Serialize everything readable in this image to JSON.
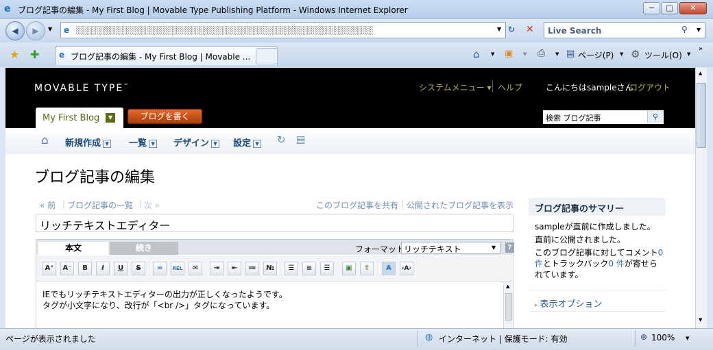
{
  "window": {
    "title": "ブログ記事の編集 - My First Blog | Movable Type Publishing Platform - Windows Internet Explorer",
    "min": "─",
    "max": "□",
    "close": "✕"
  },
  "addressbar": {
    "url_obscured": "░░░░░░░░░░░░░░░░░░░░░░░░░░░░░░░░░░░░░░░░░░░░░░░░░░░░░░░░░░░░░░░░░░░░░░░░░░░░░",
    "search_placeholder": "Live Search"
  },
  "tabs": {
    "active_label": "ブログ記事の編集 - My First Blog | Movable ...",
    "page_label": "ページ(P)",
    "tools_label": "ツール(O)"
  },
  "mt": {
    "logo": "MOVABLE TYPE",
    "logo_tm": "™",
    "system_menu": "システムメニュー ▾",
    "help": "ヘルプ",
    "greeting": "こんにちはsampleさん",
    "logout": "ログアウト",
    "blog_name": "My First Blog",
    "write_button": "ブログを書く",
    "search_placeholder": "検索 ブログ記事",
    "nav": {
      "new": "新規作成",
      "list": "一覧",
      "design": "デザイン",
      "settings": "設定"
    },
    "page_title": "ブログ記事の編集",
    "crumbs": {
      "prev": "« 前",
      "list": "ブログ記事の一覧",
      "next": "次 »",
      "share": "このブログ記事を共有",
      "view": "公開されたブログ記事を表示"
    },
    "entry_title": "リッチテキストエディター",
    "editor": {
      "tab_body": "本文",
      "tab_more": "続き",
      "format_label": "フォーマット:",
      "format_value": "リッチテキスト",
      "help": "?",
      "body_line1": "IEでもリッチテキストエディターの出力が正しくなったようです。",
      "body_line2": "タグが小文字になり、改行が「<br />」タグになっています。"
    },
    "sidebar": {
      "title": "ブログ記事のサマリー",
      "line1": "sampleが直前に作成しました。",
      "line2": "直前に公開されました。",
      "line3a": "このブログ記事に対してコメント",
      "comments": "0 件",
      "line3b": "とトラックバック",
      "trackbacks": "0 件",
      "line3c": "が寄せられています。",
      "display_options": "表示オプション"
    }
  },
  "status": {
    "left": "ページが表示されました",
    "zone": "インターネット | 保護モード: 有効",
    "zoom": "100%"
  }
}
